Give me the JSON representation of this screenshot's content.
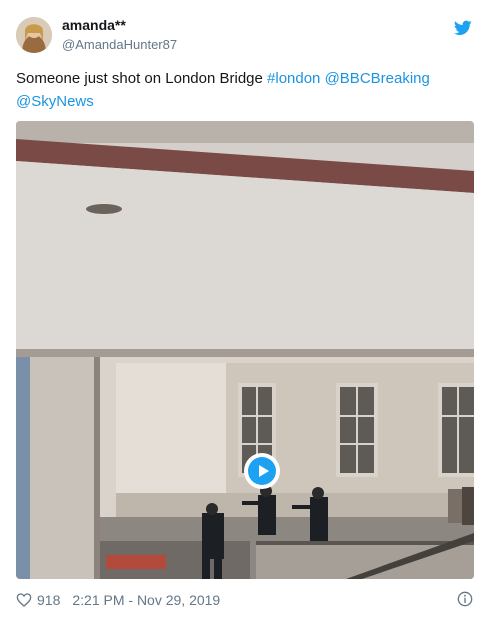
{
  "tweet": {
    "display_name": "amanda**",
    "handle": "@AmandaHunter87",
    "text_plain": "Someone just shot on London Bridge ",
    "hashtag": "#london",
    "mention1": "@BBCBreaking",
    "mention2": "@SkyNews",
    "likes": "918",
    "timestamp": "2:21 PM - Nov 29, 2019"
  },
  "icons": {
    "brand": "twitter-bird-icon",
    "play": "play-icon",
    "like": "heart-icon",
    "info": "info-icon"
  },
  "colors": {
    "link": "#1b95e0",
    "brand": "#1da1f2",
    "secondary_text": "#657786"
  }
}
